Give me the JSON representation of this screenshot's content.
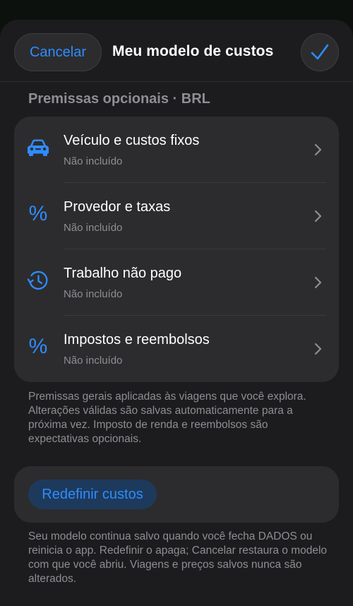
{
  "header": {
    "cancel_label": "Cancelar",
    "title": "Meu modelo de custos",
    "confirm_icon": "checkmark-icon"
  },
  "section": {
    "title": "Premissas opcionais · BRL",
    "items": [
      {
        "icon": "car-icon",
        "title": "Veículo e custos fixos",
        "subtitle": "Não incluído"
      },
      {
        "icon": "percent-icon",
        "title": "Provedor e taxas",
        "subtitle": "Não incluído"
      },
      {
        "icon": "history-clock-icon",
        "title": "Trabalho não pago",
        "subtitle": "Não incluído"
      },
      {
        "icon": "percent-icon",
        "title": "Impostos e reembolsos",
        "subtitle": "Não incluído"
      }
    ],
    "footnote": "Premissas gerais aplicadas às viagens que você explora. Alterações válidas são salvas automaticamente para a próxima vez. Imposto de renda e reembolsos são expectativas opcionais."
  },
  "reset": {
    "label": "Redefinir custos",
    "footnote": "Seu modelo continua salvo quando você fecha DADOS ou reinicia o app. Redefinir o apaga; Cancelar restaura o modelo com que você abriu. Viagens e preços salvos nunca são alterados."
  },
  "colors": {
    "accent": "#2f8cff",
    "background": "#1c1c1e",
    "card": "#2c2c2e",
    "secondary_text": "#8e8e93"
  }
}
